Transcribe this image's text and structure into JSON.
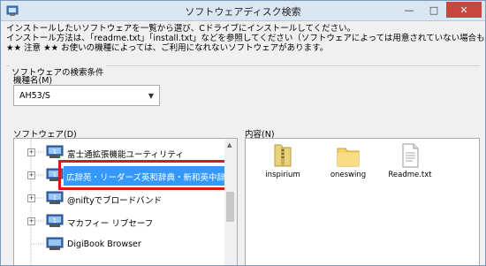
{
  "window": {
    "title": "ソフトウェアディスク検索"
  },
  "intro": {
    "line1": "インストールしたいソフトウェアを一覧から選び、Cドライブにインストールしてください。",
    "line2": "インストール方法は、「readme.txt」「install.txt」などを参照してください（ソフトウェアによっては用意されていない場合もあります）",
    "line3": "★★ 注意 ★★ お使いの機種によっては、ご利用になれないソフトウェアがあります。"
  },
  "search_group": {
    "label": "ソフトウェアの検索条件",
    "model_label": "機種名(M)",
    "model_value": "AH53/S"
  },
  "software_label": "ソフトウェア(D)",
  "contents_label": "内容(N)",
  "software_list": [
    {
      "label": "富士通拡張機能ユーティリティ"
    },
    {
      "label": "広辞苑・リーダーズ英和辞典・新和英中辞典・学研",
      "selected": true
    },
    {
      "label": "@niftyでブロードバンド"
    },
    {
      "label": "マカフィー リブセーフ"
    },
    {
      "label": "DigiBook Browser"
    }
  ],
  "contents_files": [
    {
      "name": "inspirium",
      "icon": "zip-folder-icon"
    },
    {
      "name": "oneswing",
      "icon": "folder-icon"
    },
    {
      "name": "Readme.txt",
      "icon": "text-file-icon"
    }
  ],
  "colors": {
    "selection": "#3399ff",
    "highlight_box": "#e0141e",
    "close_button": "#c7463e"
  }
}
